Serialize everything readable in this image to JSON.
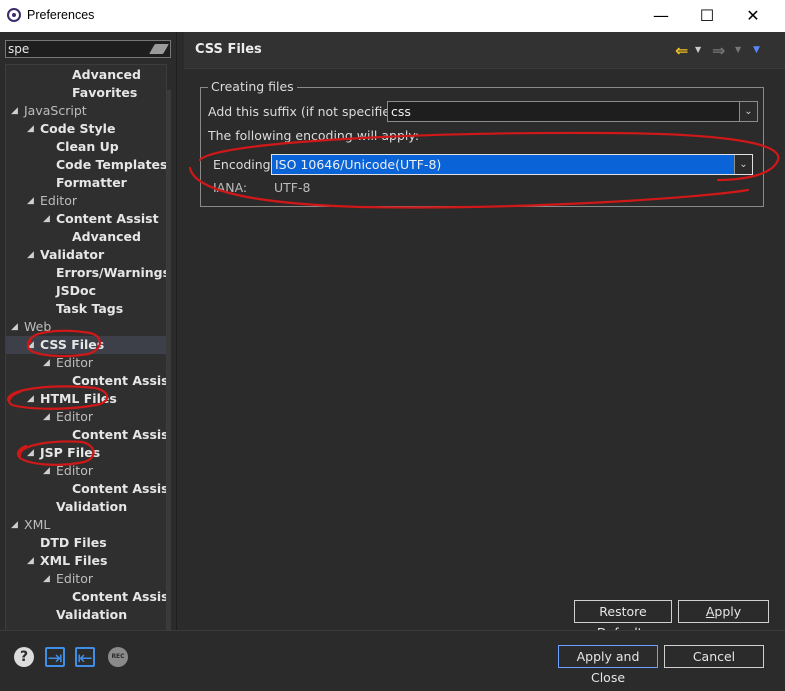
{
  "window": {
    "title": "Preferences",
    "app_icon": "eclipse-icon",
    "minimize_glyph": "—",
    "maximize_glyph": "☐",
    "close_glyph": "✕"
  },
  "filter": {
    "value": "spe",
    "clear_icon": "eraser-icon"
  },
  "tree": {
    "items": [
      {
        "label": "Advanced",
        "level": 4,
        "expanded": null,
        "bold": true
      },
      {
        "label": "Favorites",
        "level": 4,
        "expanded": null,
        "bold": true
      },
      {
        "label": "JavaScript",
        "level": 1,
        "expanded": true,
        "bold": false
      },
      {
        "label": "Code Style",
        "level": 2,
        "expanded": true,
        "bold": true
      },
      {
        "label": "Clean Up",
        "level": 3,
        "expanded": null,
        "bold": true
      },
      {
        "label": "Code Templates",
        "level": 3,
        "expanded": null,
        "bold": true
      },
      {
        "label": "Formatter",
        "level": 3,
        "expanded": null,
        "bold": true
      },
      {
        "label": "Editor",
        "level": 2,
        "expanded": true,
        "bold": false
      },
      {
        "label": "Content Assist",
        "level": 3,
        "expanded": true,
        "bold": true
      },
      {
        "label": "Advanced",
        "level": 4,
        "expanded": null,
        "bold": true
      },
      {
        "label": "Validator",
        "level": 2,
        "expanded": true,
        "bold": true
      },
      {
        "label": "Errors/Warnings",
        "level": 3,
        "expanded": null,
        "bold": true
      },
      {
        "label": "JSDoc",
        "level": 3,
        "expanded": null,
        "bold": true
      },
      {
        "label": "Task Tags",
        "level": 3,
        "expanded": null,
        "bold": true
      },
      {
        "label": "Web",
        "level": 1,
        "expanded": true,
        "bold": false
      },
      {
        "label": "CSS Files",
        "level": 2,
        "expanded": true,
        "bold": true,
        "selected": true
      },
      {
        "label": "Editor",
        "level": 3,
        "expanded": true,
        "bold": false
      },
      {
        "label": "Content Assist",
        "level": 4,
        "expanded": null,
        "bold": true
      },
      {
        "label": "HTML Files",
        "level": 2,
        "expanded": true,
        "bold": true
      },
      {
        "label": "Editor",
        "level": 3,
        "expanded": true,
        "bold": false
      },
      {
        "label": "Content Assist",
        "level": 4,
        "expanded": null,
        "bold": true
      },
      {
        "label": "JSP Files",
        "level": 2,
        "expanded": true,
        "bold": true
      },
      {
        "label": "Editor",
        "level": 3,
        "expanded": true,
        "bold": false
      },
      {
        "label": "Content Assist",
        "level": 4,
        "expanded": null,
        "bold": true
      },
      {
        "label": "Validation",
        "level": 3,
        "expanded": null,
        "bold": true
      },
      {
        "label": "XML",
        "level": 1,
        "expanded": true,
        "bold": false
      },
      {
        "label": "DTD Files",
        "level": 2,
        "expanded": null,
        "bold": true
      },
      {
        "label": "XML Files",
        "level": 2,
        "expanded": true,
        "bold": true
      },
      {
        "label": "Editor",
        "level": 3,
        "expanded": true,
        "bold": false
      },
      {
        "label": "Content Assist",
        "level": 4,
        "expanded": null,
        "bold": true
      },
      {
        "label": "Validation",
        "level": 3,
        "expanded": null,
        "bold": true
      }
    ]
  },
  "page": {
    "title": "CSS Files",
    "nav": {
      "back_icon": "back-arrow-icon",
      "forward_icon": "forward-arrow-icon",
      "menu_icon": "view-menu-icon"
    },
    "group_title": "Creating files",
    "suffix_label": "Add this suffix (if not specified):",
    "suffix_value": "css",
    "encoding_note": "The following encoding will apply:",
    "encoding_label": "Encoding:",
    "encoding_value": "ISO 10646/Unicode(UTF-8)",
    "iana_label": "IANA:",
    "iana_value": "UTF-8",
    "restore_prefix": "Restore ",
    "restore_mnemonic": "D",
    "restore_suffix": "efaults",
    "apply_mnemonic": "A",
    "apply_suffix": "pply"
  },
  "footer": {
    "apply_close": "Apply and Close",
    "cancel": "Cancel",
    "rec_label": "REC",
    "help_glyph": "?",
    "import_glyph": "⇥",
    "export_glyph": "⇤"
  },
  "colors": {
    "background": "#2b2b2b",
    "selection_blue": "#0a64d8",
    "annotation_red": "#d01818",
    "nav_arrow_yellow": "#f0c020"
  }
}
